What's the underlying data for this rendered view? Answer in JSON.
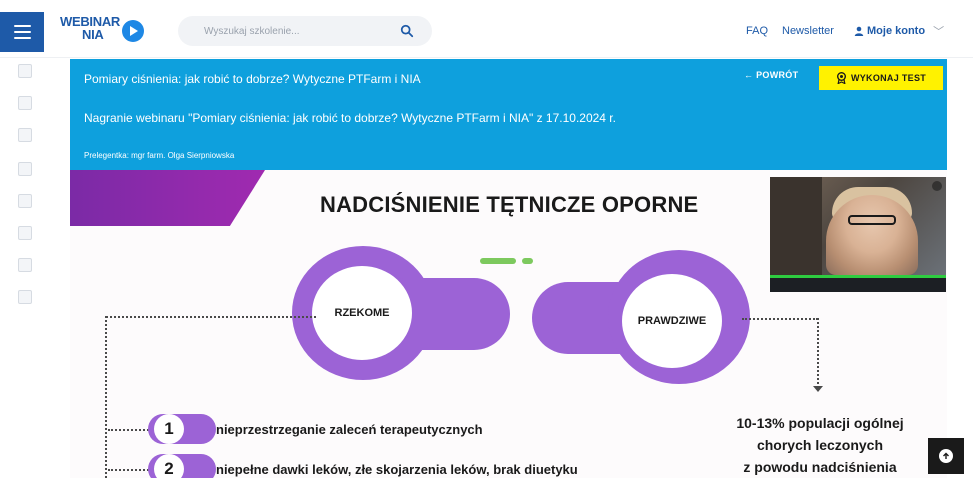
{
  "header": {
    "logo_line1": "WEBINAR",
    "logo_line2": "NIA",
    "search_placeholder": "Wyszukaj szkolenie...",
    "faq": "FAQ",
    "newsletter": "Newsletter",
    "account": "Moje konto",
    "accent_color": "#1e5aa8"
  },
  "sidebar": {
    "icons": [
      "home-icon",
      "courses-icon",
      "webinar-icon",
      "calendar-icon",
      "certificate-icon",
      "tests-icon",
      "document-icon",
      "archive-icon"
    ]
  },
  "panel": {
    "title": "Pomiary ciśnienia: jak robić to dobrze? Wytyczne PTFarm i NIA",
    "subtitle": "Nagranie webinaru \"Pomiary ciśnienia: jak robić to dobrze? Wytyczne PTFarm i NIA\" z 17.10.2024 r.",
    "speaker": "Prelegentka: mgr farm. Olga Sierpniowska",
    "back_label": "← POWRÓT",
    "test_label": "WYKONAJ TEST",
    "color": "#0ea0dd"
  },
  "slide": {
    "title": "NADCIŚNIENIE TĘTNICZE OPORNE",
    "left_label": "RZEKOME",
    "right_label": "PRAWDZIWE",
    "items": [
      {
        "num": "1",
        "text": "nieprzestrzeganie zaleceń terapeutycznych"
      },
      {
        "num": "2",
        "text": "niepełne dawki leków, złe skojarzenia leków, brak diuetyku"
      }
    ],
    "stat_lines": [
      "10-13% populacji ogólnej",
      "chorych leczonych",
      "z powodu nadciśnienia"
    ],
    "accent_purple": "#9c63d6"
  }
}
